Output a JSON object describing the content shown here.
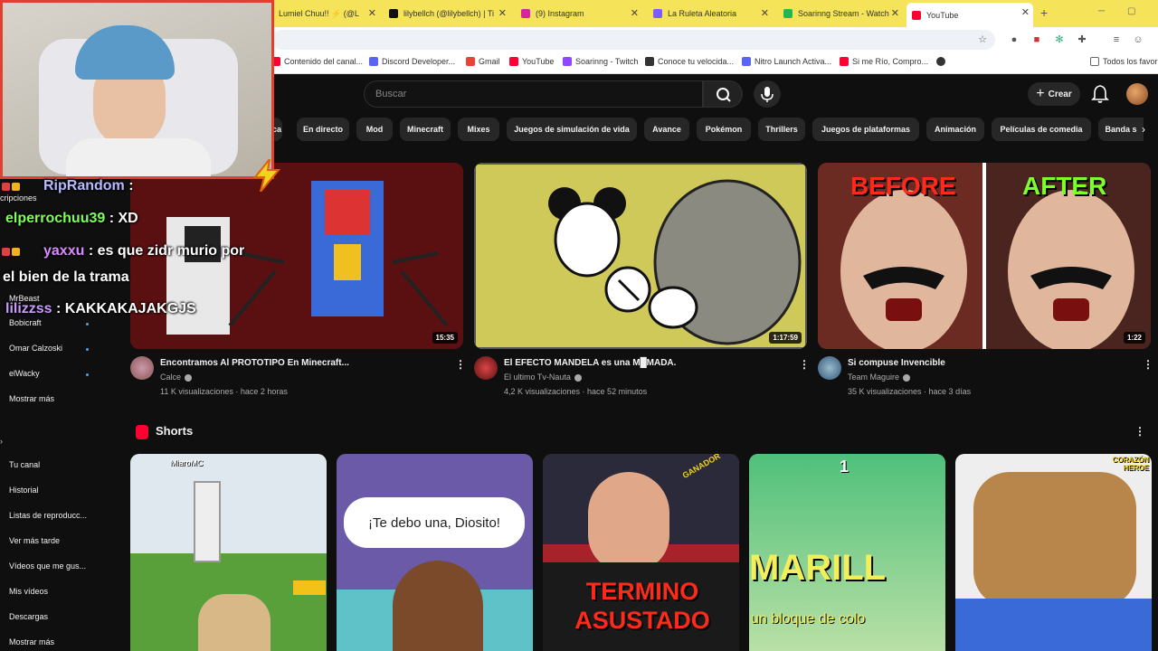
{
  "browser": {
    "tabs": [
      {
        "title": "Lumiel Chuu!! ⚡ (@L",
        "fav": "#e55"
      },
      {
        "title": "lilybellch (@lilybellch) | Ti",
        "fav": "#111"
      },
      {
        "title": "(9) Instagram",
        "fav": "#d6249f"
      },
      {
        "title": "La Ruleta Aleatoria",
        "fav": "#7b5cff"
      },
      {
        "title": "Soarinng Stream - Watch",
        "fav": "#1db954"
      },
      {
        "title": "YouTube",
        "fav": "#ff0033"
      }
    ],
    "bookmarks": [
      {
        "label": "Contenido del canal...",
        "fav": "#ff0033"
      },
      {
        "label": "Discord Developer...",
        "fav": "#5865f2"
      },
      {
        "label": "Gmail",
        "fav": "#ea4335"
      },
      {
        "label": "YouTube",
        "fav": "#ff0033"
      },
      {
        "label": "Soarinng - Twitch",
        "fav": "#9146ff"
      },
      {
        "label": "Conoce tu velocida...",
        "fav": "#333"
      },
      {
        "label": "Nitro Launch Activa...",
        "fav": "#5865f2"
      },
      {
        "label": "Si me Río, Compro...",
        "fav": "#ff0033"
      }
    ],
    "bookmarks_folder": "Todos los favorit"
  },
  "header": {
    "search_placeholder": "Buscar",
    "create_label": "Crear"
  },
  "chips": [
    "ca",
    "En directo",
    "Mod",
    "Minecraft",
    "Mixes",
    "Juegos de simulación de vida",
    "Avance",
    "Pokémon",
    "Thrillers",
    "Juegos de plataformas",
    "Animación",
    "Películas de comedia",
    "Banda s"
  ],
  "sidebar": {
    "header": "cripciones",
    "subscriptions": [
      "MrBeast",
      "Bobicraft",
      "Omar Calzoski",
      "elWacky"
    ],
    "show_more": "Mostrar más",
    "you_items": [
      "Tu canal",
      "Historial",
      "Listas de reproducc...",
      "Ver más tarde",
      "Vídeos que me gus...",
      "Mis vídeos",
      "Descargas",
      "Mostrar más"
    ]
  },
  "videos": [
    {
      "title": "Encontramos Al PROTOTIPO En Minecraft...",
      "channel": "Calce",
      "meta": "11 K visualizaciones · hace 2 horas",
      "duration": "15:35"
    },
    {
      "title": "El EFECTO MANDELA es una M█MADA.",
      "channel": "El ultimo Tv-Nauta",
      "meta": "4,2 K visualizaciones · hace 52 minutos",
      "duration": "1:17:59"
    },
    {
      "title": "Si compuse Invencible",
      "channel": "Team Maguire",
      "meta": "35 K visualizaciones · hace 3 días",
      "duration": "1:22"
    }
  ],
  "thumb_text": {
    "before": "BEFORE",
    "after": "AFTER"
  },
  "shorts": {
    "title": "Shorts",
    "items": [
      {
        "overlay": "MiaroMC"
      },
      {
        "overlay": "¡Te debo una, Diosito!"
      },
      {
        "overlay": "TERMINO ASUSTADO",
        "badge": "GANADOR"
      },
      {
        "overlay": "MARILL",
        "sub": "un bloque de colo",
        "top": "1"
      },
      {
        "overlay": "CORAZÓN HEROE"
      }
    ]
  },
  "chat": [
    {
      "user": "RipRandom",
      "msg": "",
      "color": "#b9b9ff"
    },
    {
      "user": "elperrochuu39",
      "msg": "XD",
      "color": "#7dff5a"
    },
    {
      "user": "yaxxu",
      "msg": "es que zidr murio por",
      "cont": "el bien de la trama",
      "color": "#d98cff"
    },
    {
      "user": "lilizzss",
      "msg": "KAKKAKAJAKGJS",
      "color": "#c89bff"
    }
  ]
}
